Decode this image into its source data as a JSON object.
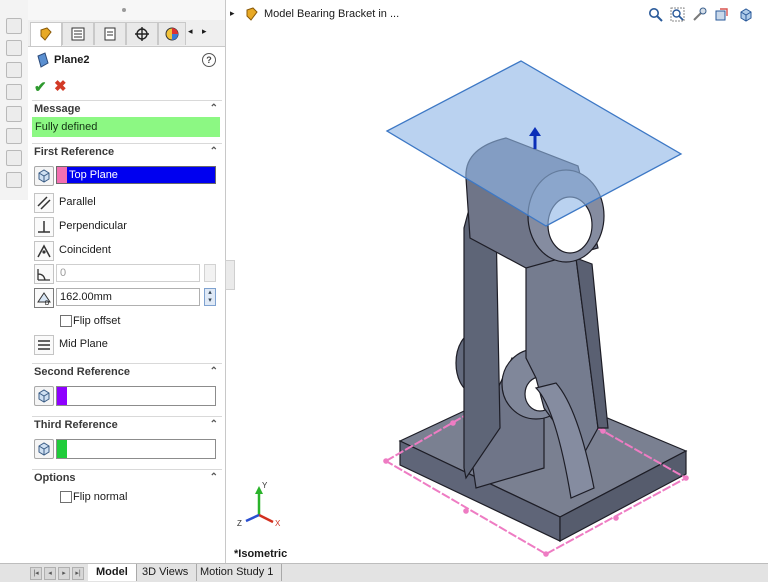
{
  "property_manager": {
    "feature_name": "Plane2",
    "tabs": [
      "feature-manager-tab",
      "property-manager-tab",
      "configuration-manager-tab",
      "dimxpert-manager-tab",
      "display-manager-tab"
    ],
    "message": {
      "header": "Message",
      "text": "Fully defined"
    },
    "first_reference": {
      "header": "First Reference",
      "selection": "Top Plane",
      "swatch_color": "#f36fb1",
      "options": [
        "Parallel",
        "Perpendicular",
        "Coincident"
      ],
      "angle_value": "0",
      "offset_value": "162.00mm",
      "flip_offset_label": "Flip offset",
      "mid_plane_label": "Mid Plane"
    },
    "second_reference": {
      "header": "Second Reference",
      "swatch_color": "#8e00ff"
    },
    "third_reference": {
      "header": "Third Reference",
      "swatch_color": "#1fcc3a"
    },
    "options": {
      "header": "Options",
      "flip_normal_label": "Flip normal"
    }
  },
  "document": {
    "title": "Model Bearing Bracket in ..."
  },
  "view": {
    "orientation_label": "*Isometric"
  },
  "bottom_tabs": [
    "Model",
    "3D Views",
    "Motion Study 1"
  ],
  "colors": {
    "fully_defined": "#8cf883",
    "selection_highlight": "#0000f0",
    "plane_fill": "#8fb7e6",
    "part": "#6b7287"
  }
}
